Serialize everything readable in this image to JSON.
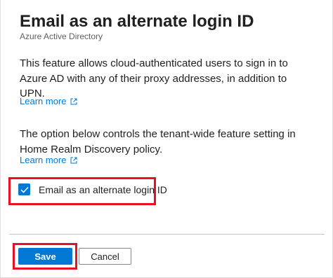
{
  "header": {
    "title": "Email as an alternate login ID",
    "more_label": "···",
    "subtitle": "Azure Active Directory"
  },
  "content": {
    "paragraph1": "This feature allows cloud-authenticated users to sign in to Azure AD with any of their proxy addresses, in addition to UPN.",
    "learn_more_1": "Learn more",
    "paragraph2": "The option below controls the tenant-wide feature setting in Home Realm Discovery policy.",
    "learn_more_2": "Learn more"
  },
  "option": {
    "checkbox_label": "Email as an alternate login ID",
    "checked": true
  },
  "footer": {
    "save_label": "Save",
    "cancel_label": "Cancel"
  },
  "colors": {
    "accent": "#0078d4",
    "highlight": "#e81123",
    "text": "#201f1e",
    "secondary_text": "#605e5c"
  },
  "icons": {
    "more": "more-ellipsis-icon",
    "external_link": "external-link-icon",
    "checkmark": "checkmark-icon"
  }
}
